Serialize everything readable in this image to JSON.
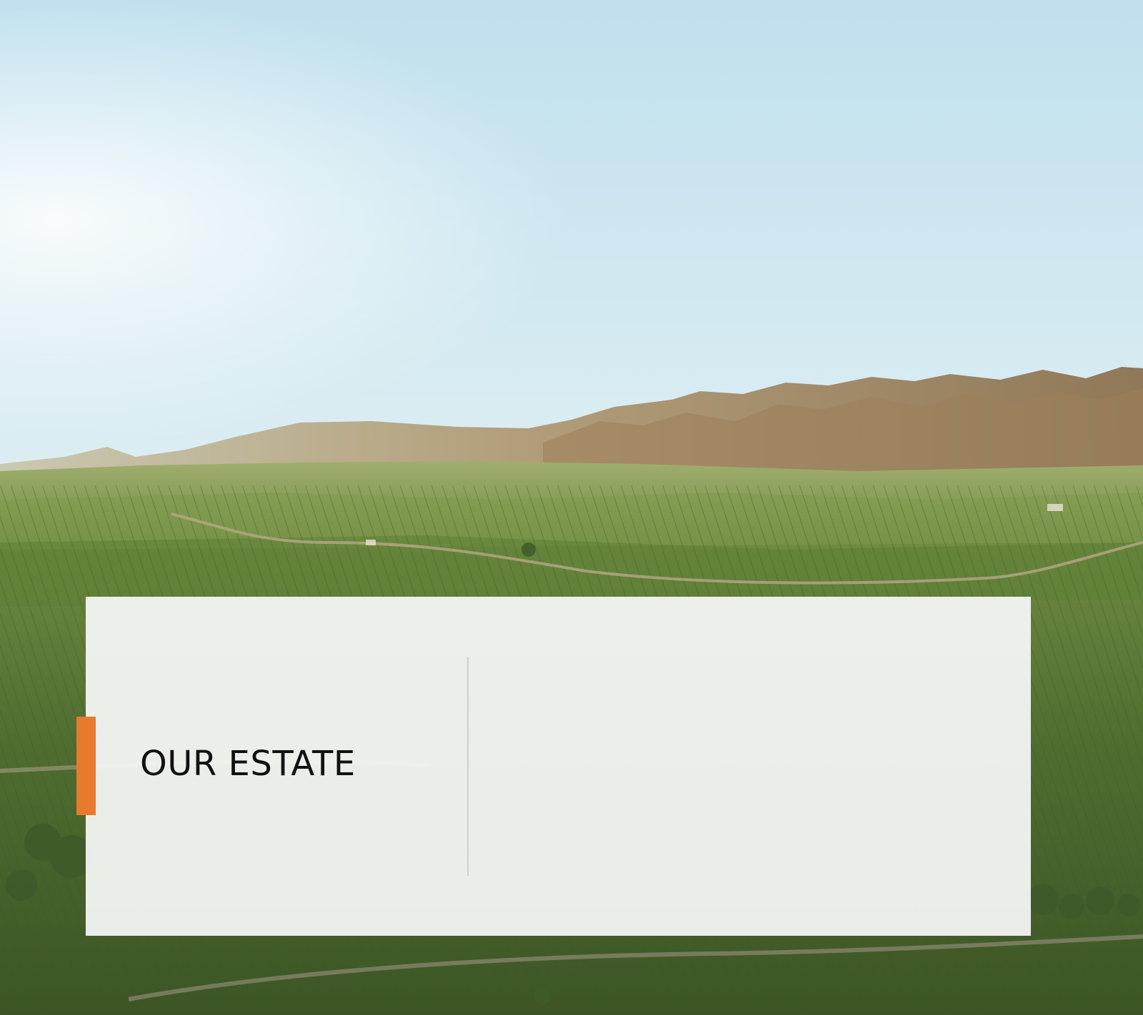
{
  "slide": {
    "title": "OUR ESTATE",
    "background_image": "vineyard-valley-landscape"
  },
  "colors": {
    "accent": "#E87A2E",
    "panel": "#F7F7F7",
    "divider": "#CFCFCF",
    "title_text": "#111111",
    "sky_top": "#BFE0EE",
    "sky_horizon": "#F7FAF6",
    "mountains": "#A98E68",
    "vineyard": "#5E7A3A"
  }
}
